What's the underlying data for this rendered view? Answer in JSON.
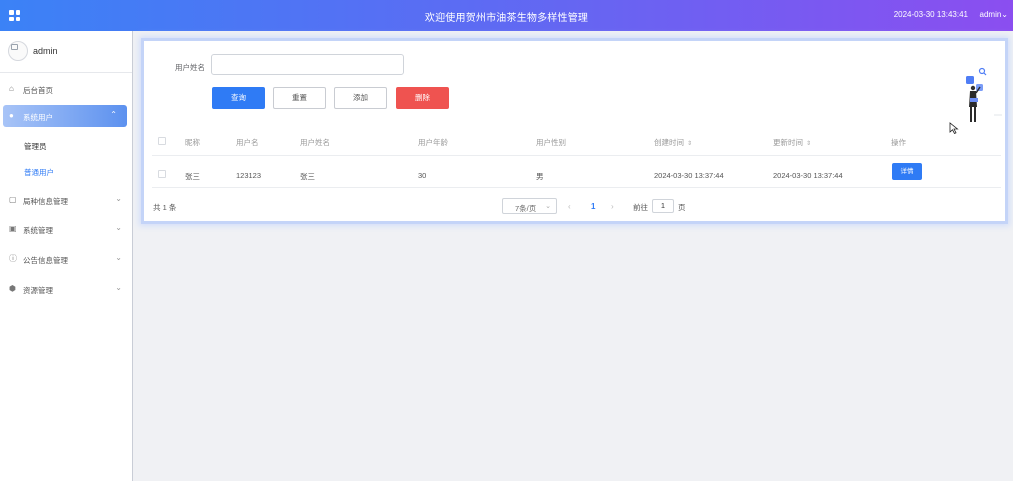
{
  "header": {
    "title": "欢迎使用贺州市油茶生物多样性管理",
    "datetime": "2024-03-30 13:43:41",
    "user": "admin",
    "user_caret": "⌄",
    "grid_icon": "grid-icon"
  },
  "sidebar": {
    "profile_name": "admin",
    "items": [
      {
        "label": "后台首页",
        "icon": "home-icon",
        "glyph": "⌂",
        "chev": ""
      },
      {
        "label": "系统用户",
        "icon": "user-icon",
        "glyph": "●",
        "chev": "⌃"
      },
      {
        "label": "局种信息管理",
        "icon": "document-icon",
        "glyph": "▢",
        "chev": "⌄"
      },
      {
        "label": "系统管理",
        "icon": "settings-icon",
        "glyph": "▣",
        "chev": "⌄"
      },
      {
        "label": "公告信息管理",
        "icon": "info-icon",
        "glyph": "ⓘ",
        "chev": "⌄"
      },
      {
        "label": "资源管理",
        "icon": "location-icon",
        "glyph": "⬢",
        "chev": "⌄"
      }
    ],
    "sub_items": [
      {
        "label": "管理员"
      },
      {
        "label": "普通用户"
      }
    ],
    "colors": {
      "active_start": "#a8c4f7",
      "active_end": "#5c91ef",
      "active_sub": "#2f7bf5"
    }
  },
  "search": {
    "label": "用户姓名",
    "value": "",
    "placeholder": ""
  },
  "buttons": {
    "query": "查询",
    "reset": "重置",
    "add": "添加",
    "delete": "删除"
  },
  "table": {
    "headers": [
      "昵称",
      "用户名",
      "用户姓名",
      "用户年龄",
      "用户性别",
      "创建时间",
      "更新时间",
      "操作"
    ],
    "sort_glyph": "⇕",
    "rows": [
      {
        "nickname": "张三",
        "username": "123123",
        "realname": "张三",
        "age": "30",
        "gender": "男",
        "created": "2024-03-30 13:37:44",
        "updated": "2024-03-30 13:37:44",
        "action": "详情"
      }
    ]
  },
  "pagination": {
    "total": "共 1 条",
    "page_size": "7条/页",
    "prev": "‹",
    "current_page": "1",
    "next": "›",
    "goto_prefix": "前往",
    "goto_value": "1",
    "goto_suffix": "页"
  },
  "colors": {
    "header_gradient_start": "#3b82f6",
    "header_gradient_end": "#8b4ef0",
    "primary": "#2f7bf5",
    "danger": "#ef5350"
  }
}
